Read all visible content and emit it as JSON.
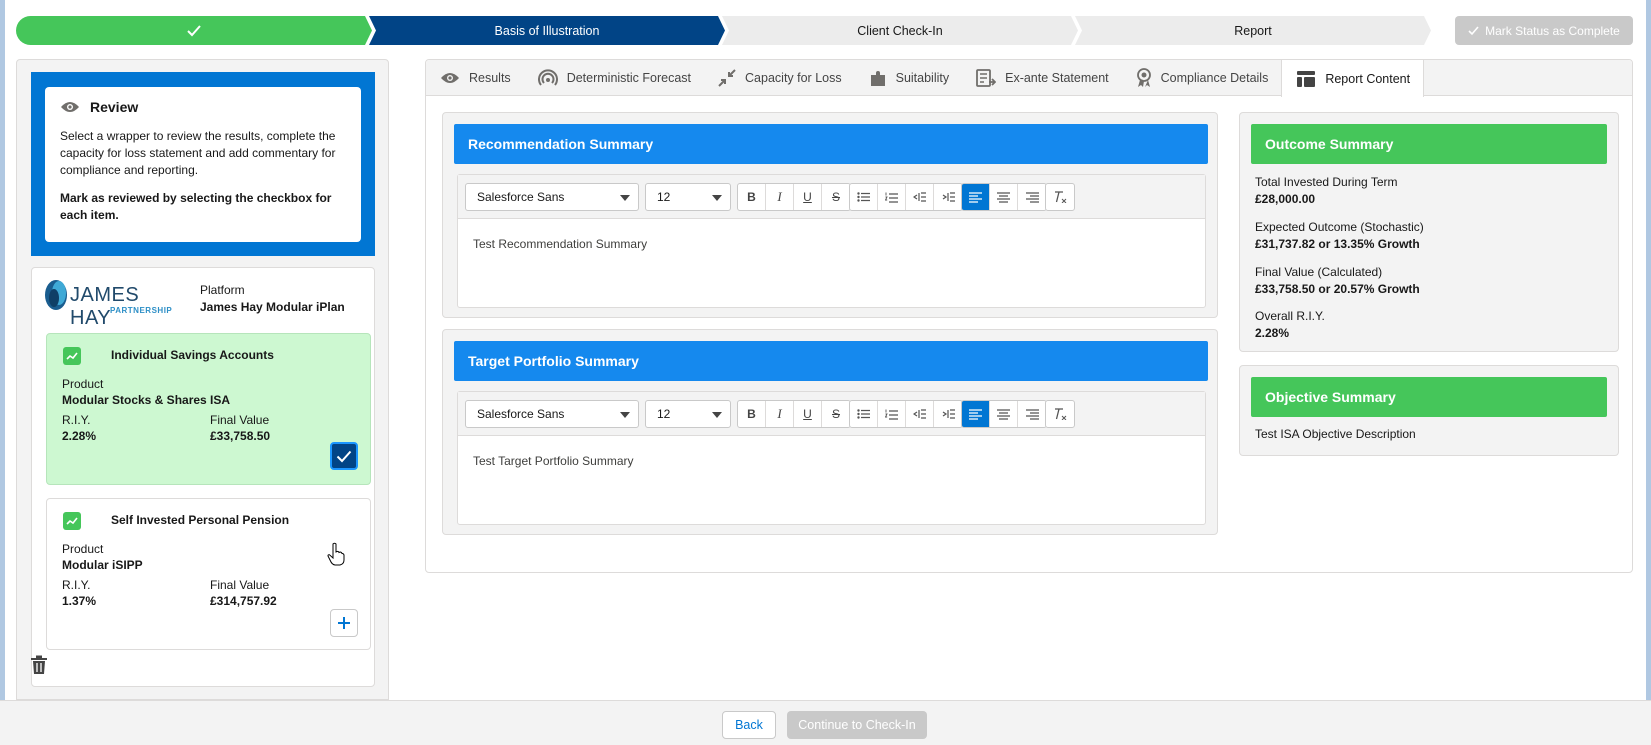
{
  "path": {
    "steps": [
      {
        "label": "",
        "state": "complete"
      },
      {
        "label": "Basis of Illustration",
        "state": "current"
      },
      {
        "label": "Client Check-In",
        "state": "incomplete"
      },
      {
        "label": "Report",
        "state": "incomplete"
      }
    ],
    "mark_complete_label": "Mark Status as Complete"
  },
  "review": {
    "title": "Review",
    "text": "Select a wrapper to review the results, complete the capacity for loss statement and add commentary for compliance and reporting.",
    "bold_text": "Mark as reviewed by selecting the checkbox for each item."
  },
  "platform": {
    "logo_text": "JAMES HAY",
    "logo_subtext": "PARTNERSHIP",
    "label": "Platform",
    "value": "James Hay Modular iPlan",
    "products": [
      {
        "name": "Individual Savings Accounts",
        "product_label": "Product",
        "product_value": "Modular Stocks & Shares ISA",
        "riy_label": "R.I.Y.",
        "riy_value": "2.28%",
        "fv_label": "Final Value",
        "fv_value": "£33,758.50",
        "reviewed": true
      },
      {
        "name": "Self Invested Personal Pension",
        "product_label": "Product",
        "product_value": "Modular iSIPP",
        "riy_label": "R.I.Y.",
        "riy_value": "1.37%",
        "fv_label": "Final Value",
        "fv_value": "£314,757.92",
        "reviewed": false
      }
    ]
  },
  "tabs": [
    {
      "label": "Results",
      "icon": "eye-icon"
    },
    {
      "label": "Deterministic Forecast",
      "icon": "forecast-icon"
    },
    {
      "label": "Capacity for Loss",
      "icon": "contract-icon"
    },
    {
      "label": "Suitability",
      "icon": "puzzle-icon"
    },
    {
      "label": "Ex-ante Statement",
      "icon": "statement-icon"
    },
    {
      "label": "Compliance Details",
      "icon": "award-icon"
    },
    {
      "label": "Report Content",
      "icon": "layout-icon",
      "active": true
    }
  ],
  "editors": [
    {
      "title": "Recommendation Summary",
      "font": "Salesforce Sans",
      "size": "12",
      "content": "Test Recommendation Summary"
    },
    {
      "title": "Target Portfolio Summary",
      "font": "Salesforce Sans",
      "size": "12",
      "content": "Test Target Portfolio Summary"
    }
  ],
  "outcome": {
    "title": "Outcome Summary",
    "items": [
      {
        "label": "Total Invested During Term",
        "value": "£28,000.00"
      },
      {
        "label": "Expected Outcome (Stochastic)",
        "value": "£31,737.82 or 13.35% Growth"
      },
      {
        "label": "Final Value (Calculated)",
        "value": "£33,758.50 or 20.57% Growth"
      },
      {
        "label": "Overall R.I.Y.",
        "value": "2.28%"
      }
    ]
  },
  "objective": {
    "title": "Objective Summary",
    "text": "Test ISA Objective Description"
  },
  "footer": {
    "back_label": "Back",
    "continue_label": "Continue to Check-In"
  },
  "colors": {
    "brand_blue": "#0176d3",
    "header_blue": "#1589ee",
    "path_current": "#014486",
    "success_green": "#45c65a",
    "selected_card": "#cdf8d1"
  }
}
